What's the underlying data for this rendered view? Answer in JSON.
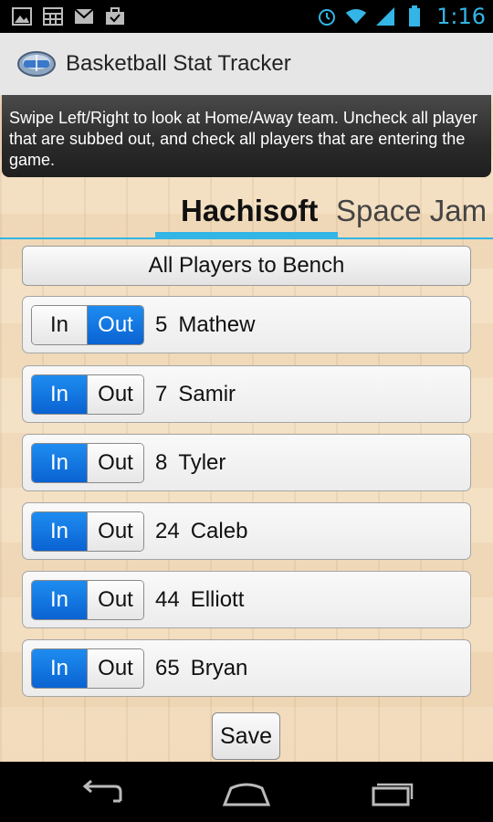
{
  "status_bar": {
    "time": "1:16",
    "left_icons": [
      "gallery-icon",
      "calendar-icon",
      "gmail-icon",
      "briefcase-icon"
    ],
    "right_icons": [
      "alarm-icon",
      "wifi-icon",
      "signal-icon",
      "battery-icon"
    ]
  },
  "app": {
    "title": "Basketball Stat Tracker",
    "icon": "basketball-court-icon"
  },
  "banner": {
    "text": "Swipe Left/Right to look at Home/Away team. Uncheck all player that are subbed out, and check all players that are entering the game."
  },
  "tabs": [
    {
      "label": "Hachisoft",
      "selected": true
    },
    {
      "label": "Space Jam",
      "selected": false
    }
  ],
  "bench_button": {
    "label": "All Players to Bench"
  },
  "toggle": {
    "in_label": "In",
    "out_label": "Out"
  },
  "players": [
    {
      "number": "5",
      "name": "Mathew",
      "status": "Out"
    },
    {
      "number": "7",
      "name": "Samir",
      "status": "In"
    },
    {
      "number": "8",
      "name": "Tyler",
      "status": "In"
    },
    {
      "number": "24",
      "name": "Caleb",
      "status": "In"
    },
    {
      "number": "44",
      "name": "Elliott",
      "status": "In"
    },
    {
      "number": "65",
      "name": "Bryan",
      "status": "In"
    }
  ],
  "save_button": {
    "label": "Save"
  },
  "nav_bar": {
    "icons": [
      "back-icon",
      "home-icon",
      "recent-apps-icon"
    ]
  },
  "colors": {
    "accent": "#33b5e5",
    "toggle_active": "#0a63d2"
  }
}
